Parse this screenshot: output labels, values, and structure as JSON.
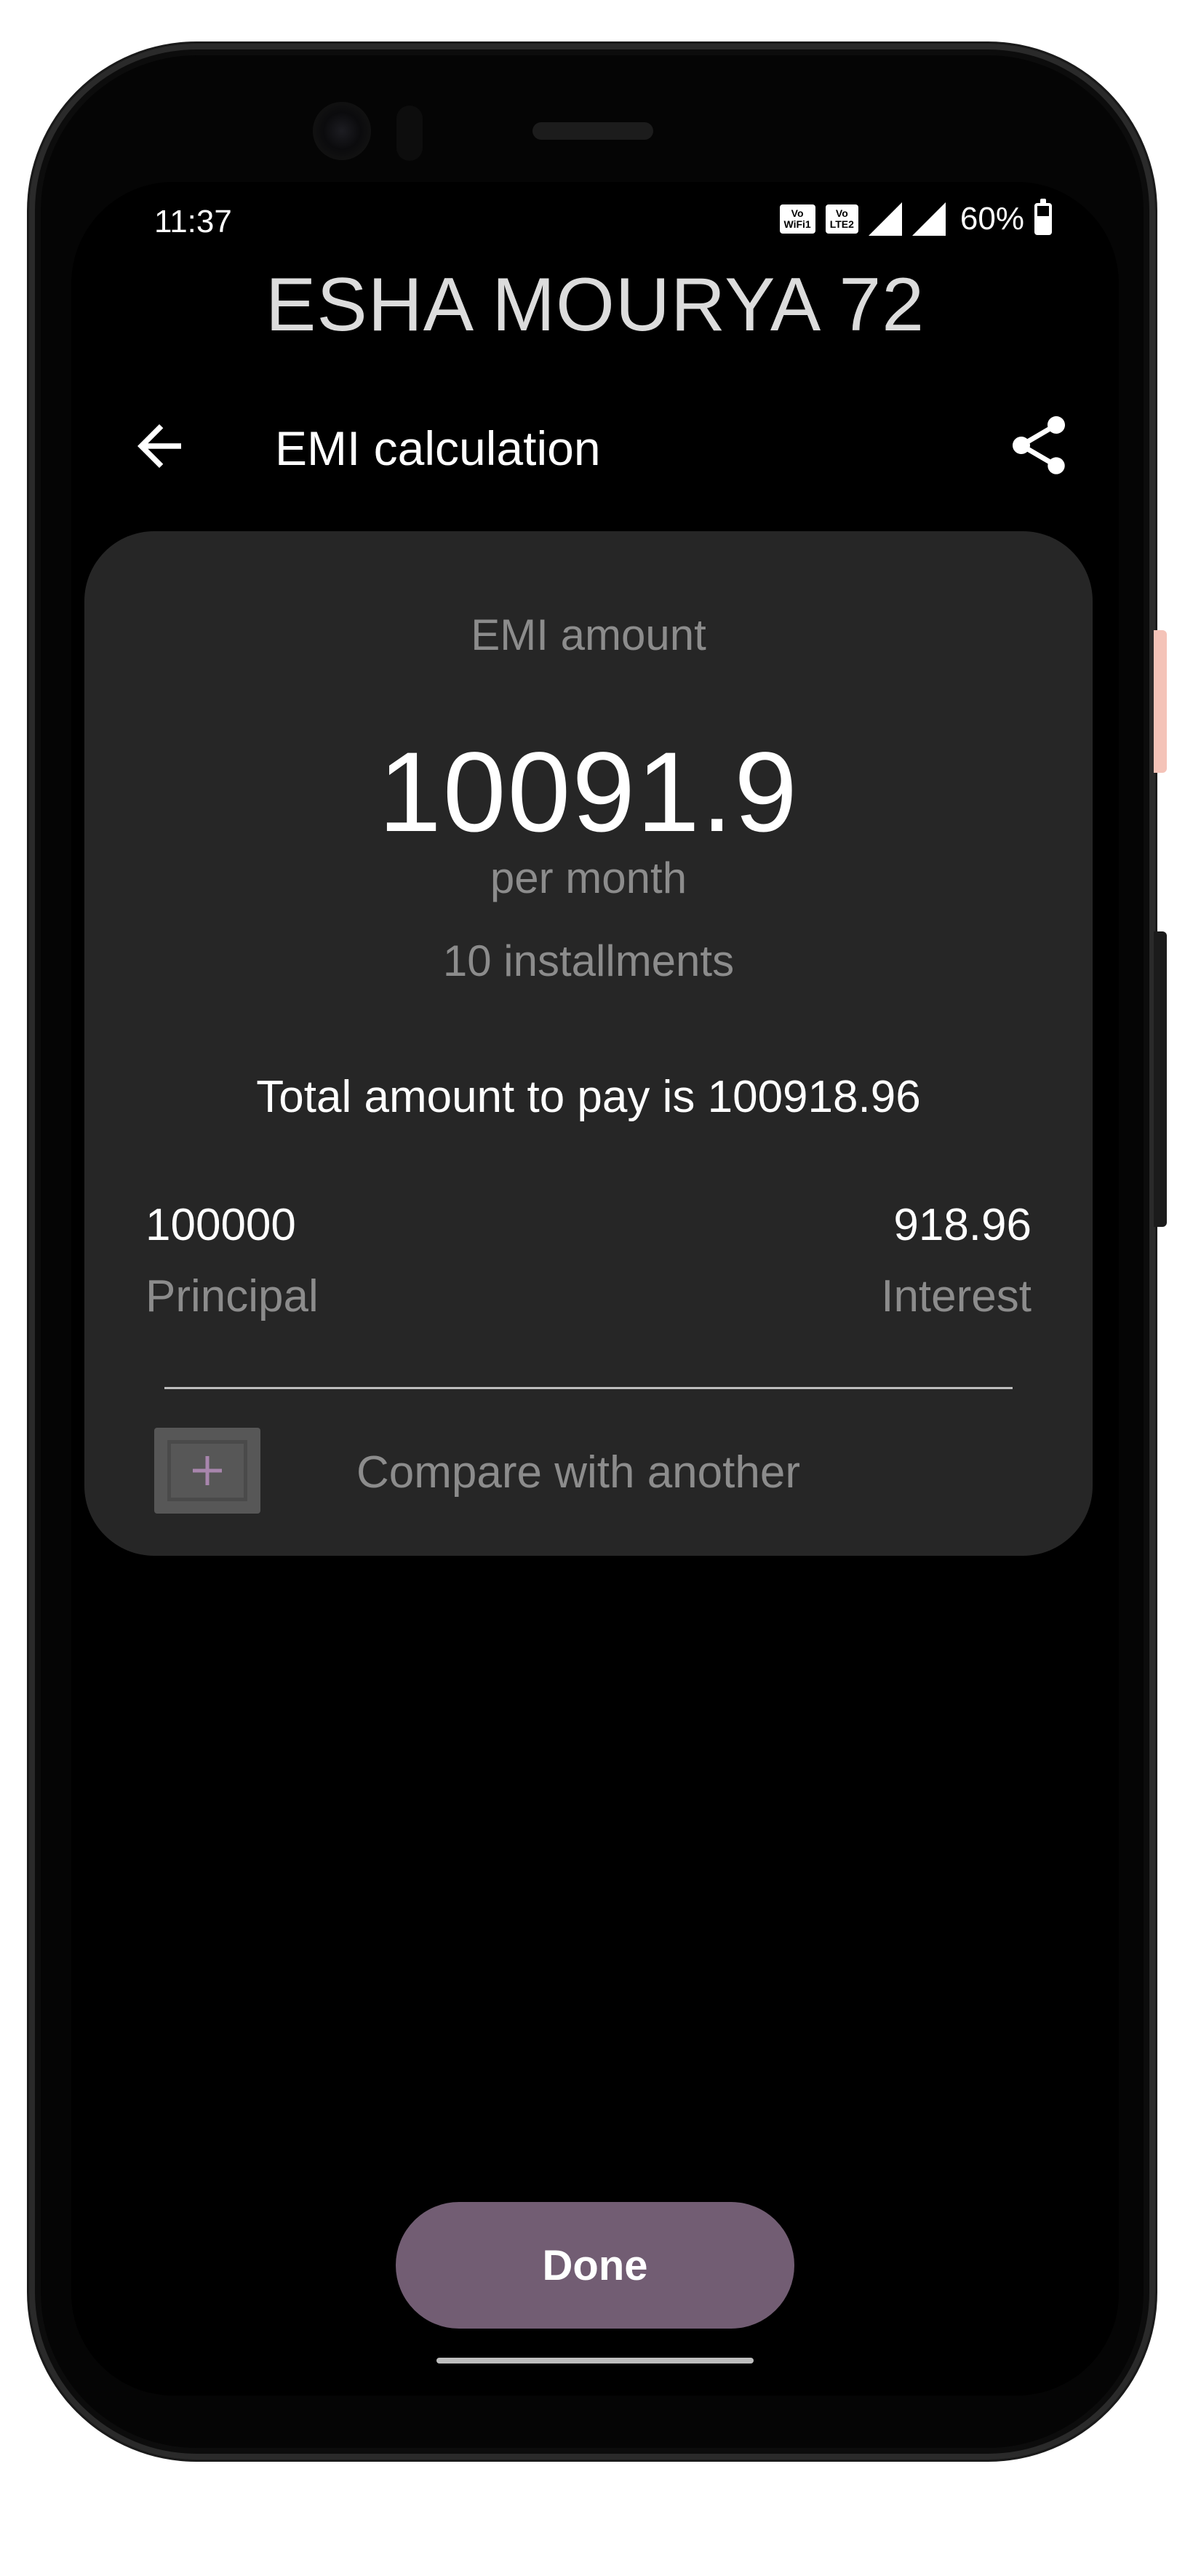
{
  "status_bar": {
    "time": "11:37",
    "wifi_chip": [
      "Vo",
      "WiFi1"
    ],
    "lte_chip": [
      "Vo",
      "LTE2"
    ],
    "battery_text": "60%",
    "battery_level": 0.6
  },
  "header": {
    "title": "ESHA MOURYA 72"
  },
  "appbar": {
    "title": "EMI calculation",
    "back_icon": "arrow-back-icon",
    "share_icon": "share-icon"
  },
  "emi": {
    "label": "EMI amount",
    "value": "10091.9",
    "per": "per month",
    "installments": "10 installments",
    "total_text": "Total amount to pay is 100918.96",
    "principal_value": "100000",
    "principal_label": "Principal",
    "interest_value": "918.96",
    "interest_label": "Interest",
    "compare_label": "Compare with another",
    "compare_icon": "plus-icon"
  },
  "footer": {
    "done_label": "Done"
  },
  "colors": {
    "accent": "#725d73",
    "card": "#262626",
    "muted_text": "#8c8c8c",
    "plus": "#a886ad"
  }
}
